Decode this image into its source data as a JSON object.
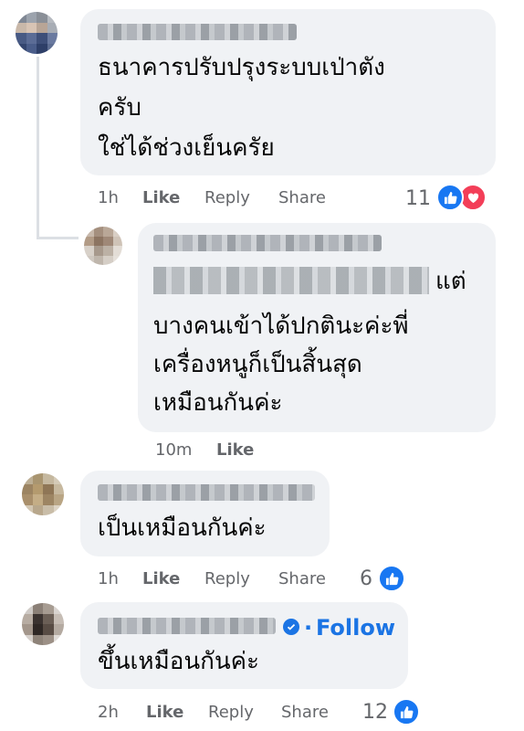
{
  "comments": [
    {
      "text_lines": [
        "ธนาคารปรับปรุงระบบเป่าตัง",
        "ครับ",
        "ใช่ได้ช่วงเย็นครัย"
      ],
      "time": "1h",
      "like": "Like",
      "reply": "Reply",
      "share": "Share",
      "reaction_count": "11",
      "reactions": [
        "like-icon",
        "love-icon"
      ]
    },
    {
      "text_tail": "แต่",
      "text_lines": [
        "บางคนเข้าได้ปกตินะค่ะพี่",
        "เครื่องหนูก็เป็นสิ้นสุด",
        "เหมือนกันค่ะ"
      ],
      "time": "10m",
      "like": "Like"
    },
    {
      "text_lines": [
        "เป็นเหมือนกันค่ะ"
      ],
      "time": "1h",
      "like": "Like",
      "reply": "Reply",
      "share": "Share",
      "reaction_count": "6",
      "reactions": [
        "like-icon"
      ]
    },
    {
      "follow_label": "Follow",
      "follow_separator": "·",
      "text_lines": [
        "ขึ้นเหมือนกันค่ะ"
      ],
      "time": "2h",
      "like": "Like",
      "reply": "Reply",
      "share": "Share",
      "reaction_count": "12",
      "reactions": [
        "like-icon"
      ]
    }
  ],
  "colors": {
    "bubble": "#f0f2f5",
    "meta_text": "#65676b",
    "like_blue": "#1877f2",
    "love_red": "#f33e58",
    "follow_blue": "#1b74e4"
  }
}
